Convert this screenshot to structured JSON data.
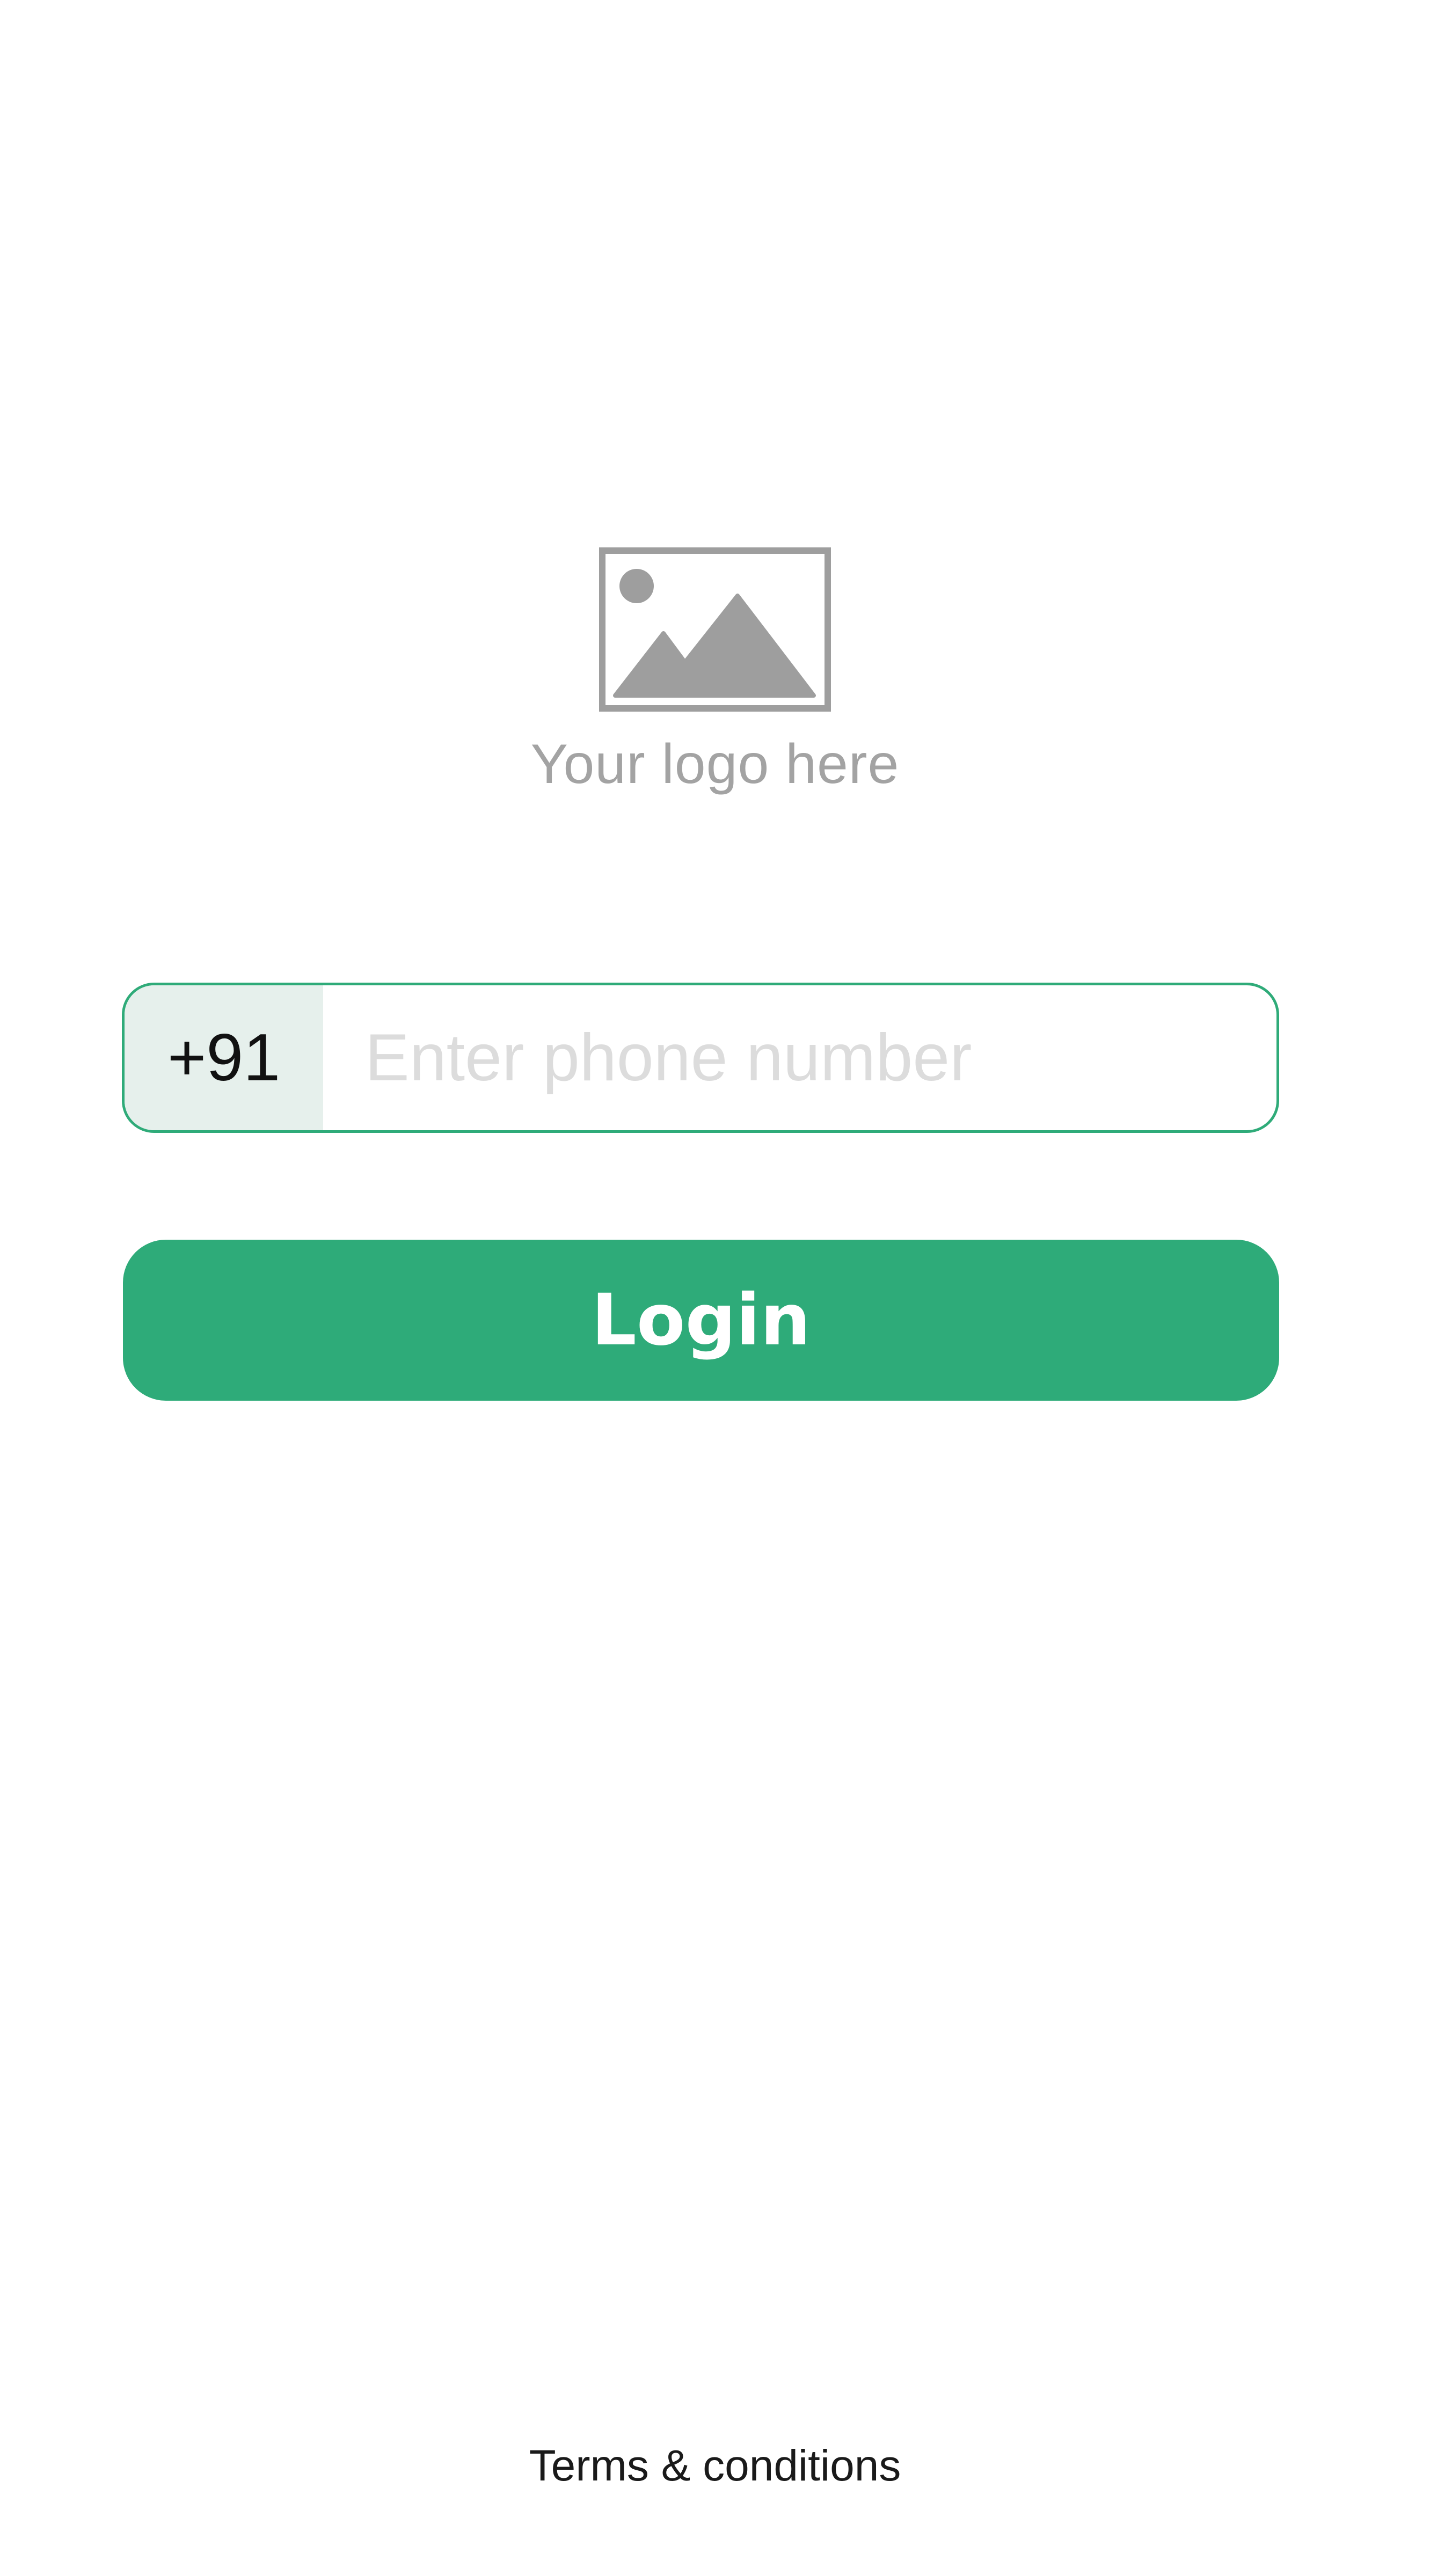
{
  "logo": {
    "icon": "image-placeholder-icon",
    "text": "Your logo here"
  },
  "phone": {
    "country_code": "+91",
    "value": "",
    "placeholder": "Enter phone number"
  },
  "login_button": {
    "label": "Login"
  },
  "footer": {
    "terms_label": "Terms & conditions"
  },
  "colors": {
    "accent": "#2eab79",
    "country_code_bg": "#e6f0ec",
    "logo_gray": "#a3a3a3",
    "placeholder_gray": "#dcdcdc"
  }
}
